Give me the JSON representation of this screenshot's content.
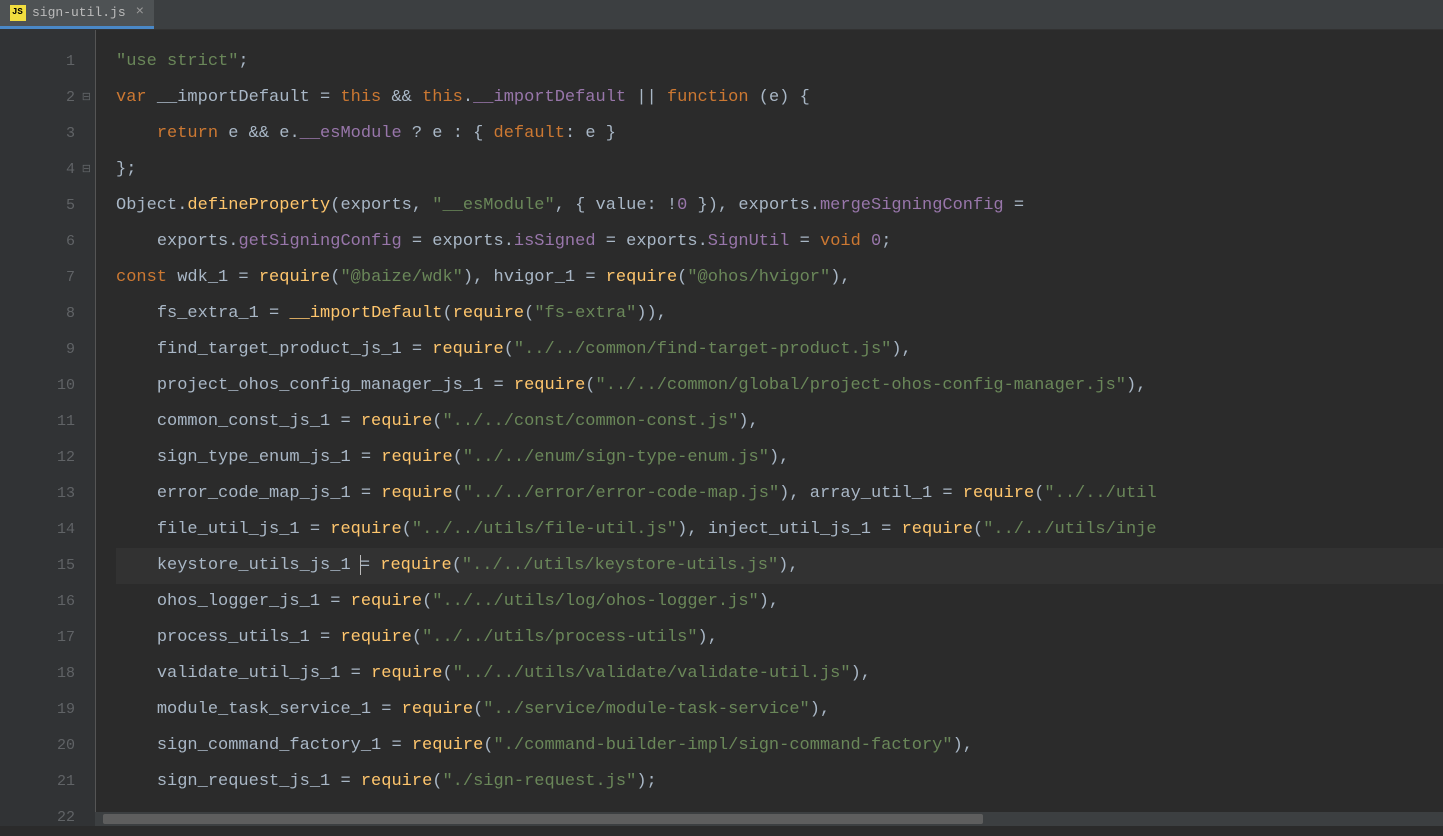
{
  "tab": {
    "filename": "sign-util.js",
    "icon_label": "JS"
  },
  "gutter": {
    "lines": [
      "1",
      "2",
      "3",
      "4",
      "5",
      "6",
      "7",
      "8",
      "9",
      "10",
      "11",
      "12",
      "13",
      "14",
      "15",
      "16",
      "17",
      "18",
      "19",
      "20",
      "21",
      "22"
    ]
  },
  "code": {
    "current_line_index": 14,
    "lines": [
      [
        {
          "t": "str",
          "v": "\"use strict\""
        },
        {
          "t": "op",
          "v": ";"
        }
      ],
      [
        {
          "t": "kw",
          "v": "var"
        },
        {
          "t": "op",
          "v": " "
        },
        {
          "t": "ident",
          "v": "__importDefault"
        },
        {
          "t": "op",
          "v": " = "
        },
        {
          "t": "kw",
          "v": "this"
        },
        {
          "t": "op",
          "v": " && "
        },
        {
          "t": "kw",
          "v": "this"
        },
        {
          "t": "op",
          "v": "."
        },
        {
          "t": "prop",
          "v": "__importDefault"
        },
        {
          "t": "op",
          "v": " || "
        },
        {
          "t": "kw",
          "v": "function"
        },
        {
          "t": "op",
          "v": " ("
        },
        {
          "t": "ident",
          "v": "e"
        },
        {
          "t": "op",
          "v": ") {"
        }
      ],
      [
        {
          "t": "op",
          "v": "    "
        },
        {
          "t": "kw",
          "v": "return"
        },
        {
          "t": "op",
          "v": " "
        },
        {
          "t": "ident",
          "v": "e"
        },
        {
          "t": "op",
          "v": " && "
        },
        {
          "t": "ident",
          "v": "e"
        },
        {
          "t": "op",
          "v": "."
        },
        {
          "t": "prop",
          "v": "__esModule"
        },
        {
          "t": "op",
          "v": " ? "
        },
        {
          "t": "ident",
          "v": "e"
        },
        {
          "t": "op",
          "v": " : { "
        },
        {
          "t": "kw",
          "v": "default"
        },
        {
          "t": "op",
          "v": ": "
        },
        {
          "t": "ident",
          "v": "e"
        },
        {
          "t": "op",
          "v": " }"
        }
      ],
      [
        {
          "t": "op",
          "v": "};"
        }
      ],
      [
        {
          "t": "ident",
          "v": "Object"
        },
        {
          "t": "op",
          "v": "."
        },
        {
          "t": "fn",
          "v": "defineProperty"
        },
        {
          "t": "op",
          "v": "("
        },
        {
          "t": "ident",
          "v": "exports"
        },
        {
          "t": "op",
          "v": ", "
        },
        {
          "t": "str",
          "v": "\"__esModule\""
        },
        {
          "t": "op",
          "v": ", { "
        },
        {
          "t": "ident",
          "v": "value"
        },
        {
          "t": "op",
          "v": ": !"
        },
        {
          "t": "prop",
          "v": "0"
        },
        {
          "t": "op",
          "v": " }), "
        },
        {
          "t": "ident",
          "v": "exports"
        },
        {
          "t": "op",
          "v": "."
        },
        {
          "t": "prop",
          "v": "mergeSigningConfig"
        },
        {
          "t": "op",
          "v": " ="
        }
      ],
      [
        {
          "t": "op",
          "v": "    "
        },
        {
          "t": "ident",
          "v": "exports"
        },
        {
          "t": "op",
          "v": "."
        },
        {
          "t": "prop",
          "v": "getSigningConfig"
        },
        {
          "t": "op",
          "v": " = "
        },
        {
          "t": "ident",
          "v": "exports"
        },
        {
          "t": "op",
          "v": "."
        },
        {
          "t": "prop",
          "v": "isSigned"
        },
        {
          "t": "op",
          "v": " = "
        },
        {
          "t": "ident",
          "v": "exports"
        },
        {
          "t": "op",
          "v": "."
        },
        {
          "t": "prop",
          "v": "SignUtil"
        },
        {
          "t": "op",
          "v": " = "
        },
        {
          "t": "kw",
          "v": "void"
        },
        {
          "t": "op",
          "v": " "
        },
        {
          "t": "prop",
          "v": "0"
        },
        {
          "t": "op",
          "v": ";"
        }
      ],
      [
        {
          "t": "kw",
          "v": "const"
        },
        {
          "t": "op",
          "v": " "
        },
        {
          "t": "ident",
          "v": "wdk_1"
        },
        {
          "t": "op",
          "v": " = "
        },
        {
          "t": "fn",
          "v": "require"
        },
        {
          "t": "op",
          "v": "("
        },
        {
          "t": "str",
          "v": "\"@baize/wdk\""
        },
        {
          "t": "op",
          "v": "), "
        },
        {
          "t": "ident",
          "v": "hvigor_1"
        },
        {
          "t": "op",
          "v": " = "
        },
        {
          "t": "fn",
          "v": "require"
        },
        {
          "t": "op",
          "v": "("
        },
        {
          "t": "str",
          "v": "\"@ohos/hvigor\""
        },
        {
          "t": "op",
          "v": "),"
        }
      ],
      [
        {
          "t": "op",
          "v": "    "
        },
        {
          "t": "ident",
          "v": "fs_extra_1"
        },
        {
          "t": "op",
          "v": " = "
        },
        {
          "t": "fn",
          "v": "__importDefault"
        },
        {
          "t": "op",
          "v": "("
        },
        {
          "t": "fn",
          "v": "require"
        },
        {
          "t": "op",
          "v": "("
        },
        {
          "t": "str",
          "v": "\"fs-extra\""
        },
        {
          "t": "op",
          "v": ")),"
        }
      ],
      [
        {
          "t": "op",
          "v": "    "
        },
        {
          "t": "ident",
          "v": "find_target_product_js_1"
        },
        {
          "t": "op",
          "v": " = "
        },
        {
          "t": "fn",
          "v": "require"
        },
        {
          "t": "op",
          "v": "("
        },
        {
          "t": "str",
          "v": "\"../../common/find-target-product.js\""
        },
        {
          "t": "op",
          "v": "),"
        }
      ],
      [
        {
          "t": "op",
          "v": "    "
        },
        {
          "t": "ident",
          "v": "project_ohos_config_manager_js_1"
        },
        {
          "t": "op",
          "v": " = "
        },
        {
          "t": "fn",
          "v": "require"
        },
        {
          "t": "op",
          "v": "("
        },
        {
          "t": "str",
          "v": "\"../../common/global/project-ohos-config-manager.js\""
        },
        {
          "t": "op",
          "v": "),"
        }
      ],
      [
        {
          "t": "op",
          "v": "    "
        },
        {
          "t": "ident",
          "v": "common_const_js_1"
        },
        {
          "t": "op",
          "v": " = "
        },
        {
          "t": "fn",
          "v": "require"
        },
        {
          "t": "op",
          "v": "("
        },
        {
          "t": "str",
          "v": "\"../../const/common-const.js\""
        },
        {
          "t": "op",
          "v": "),"
        }
      ],
      [
        {
          "t": "op",
          "v": "    "
        },
        {
          "t": "ident",
          "v": "sign_type_enum_js_1"
        },
        {
          "t": "op",
          "v": " = "
        },
        {
          "t": "fn",
          "v": "require"
        },
        {
          "t": "op",
          "v": "("
        },
        {
          "t": "str",
          "v": "\"../../enum/sign-type-enum.js\""
        },
        {
          "t": "op",
          "v": "),"
        }
      ],
      [
        {
          "t": "op",
          "v": "    "
        },
        {
          "t": "ident",
          "v": "error_code_map_js_1"
        },
        {
          "t": "op",
          "v": " = "
        },
        {
          "t": "fn",
          "v": "require"
        },
        {
          "t": "op",
          "v": "("
        },
        {
          "t": "str",
          "v": "\"../../error/error-code-map.js\""
        },
        {
          "t": "op",
          "v": "), "
        },
        {
          "t": "ident",
          "v": "array_util_1"
        },
        {
          "t": "op",
          "v": " = "
        },
        {
          "t": "fn",
          "v": "require"
        },
        {
          "t": "op",
          "v": "("
        },
        {
          "t": "str",
          "v": "\"../../util"
        }
      ],
      [
        {
          "t": "op",
          "v": "    "
        },
        {
          "t": "ident",
          "v": "file_util_js_1"
        },
        {
          "t": "op",
          "v": " = "
        },
        {
          "t": "fn",
          "v": "require"
        },
        {
          "t": "op",
          "v": "("
        },
        {
          "t": "str",
          "v": "\"../../utils/file-util.js\""
        },
        {
          "t": "op",
          "v": "), "
        },
        {
          "t": "ident",
          "v": "inject_util_js_1"
        },
        {
          "t": "op",
          "v": " = "
        },
        {
          "t": "fn",
          "v": "require"
        },
        {
          "t": "op",
          "v": "("
        },
        {
          "t": "str",
          "v": "\"../../utils/inje"
        }
      ],
      [
        {
          "t": "op",
          "v": "    "
        },
        {
          "t": "ident",
          "v": "keystore_utils_js_1"
        },
        {
          "t": "op",
          "v": " "
        },
        {
          "t": "cursor",
          "v": ""
        },
        {
          "t": "op",
          "v": "= "
        },
        {
          "t": "fn",
          "v": "require"
        },
        {
          "t": "op",
          "v": "("
        },
        {
          "t": "str",
          "v": "\"../../utils/keystore-utils.js\""
        },
        {
          "t": "op",
          "v": "),"
        }
      ],
      [
        {
          "t": "op",
          "v": "    "
        },
        {
          "t": "ident",
          "v": "ohos_logger_js_1"
        },
        {
          "t": "op",
          "v": " = "
        },
        {
          "t": "fn",
          "v": "require"
        },
        {
          "t": "op",
          "v": "("
        },
        {
          "t": "str",
          "v": "\"../../utils/log/ohos-logger.js\""
        },
        {
          "t": "op",
          "v": "),"
        }
      ],
      [
        {
          "t": "op",
          "v": "    "
        },
        {
          "t": "ident",
          "v": "process_utils_1"
        },
        {
          "t": "op",
          "v": " = "
        },
        {
          "t": "fn",
          "v": "require"
        },
        {
          "t": "op",
          "v": "("
        },
        {
          "t": "str",
          "v": "\"../../utils/process-utils\""
        },
        {
          "t": "op",
          "v": "),"
        }
      ],
      [
        {
          "t": "op",
          "v": "    "
        },
        {
          "t": "ident",
          "v": "validate_util_js_1"
        },
        {
          "t": "op",
          "v": " = "
        },
        {
          "t": "fn",
          "v": "require"
        },
        {
          "t": "op",
          "v": "("
        },
        {
          "t": "str",
          "v": "\"../../utils/validate/validate-util.js\""
        },
        {
          "t": "op",
          "v": "),"
        }
      ],
      [
        {
          "t": "op",
          "v": "    "
        },
        {
          "t": "ident",
          "v": "module_task_service_1"
        },
        {
          "t": "op",
          "v": " = "
        },
        {
          "t": "fn",
          "v": "require"
        },
        {
          "t": "op",
          "v": "("
        },
        {
          "t": "str",
          "v": "\"../service/module-task-service\""
        },
        {
          "t": "op",
          "v": "),"
        }
      ],
      [
        {
          "t": "op",
          "v": "    "
        },
        {
          "t": "ident",
          "v": "sign_command_factory_1"
        },
        {
          "t": "op",
          "v": " = "
        },
        {
          "t": "fn",
          "v": "require"
        },
        {
          "t": "op",
          "v": "("
        },
        {
          "t": "str",
          "v": "\"./command-builder-impl/sign-command-factory\""
        },
        {
          "t": "op",
          "v": "),"
        }
      ],
      [
        {
          "t": "op",
          "v": "    "
        },
        {
          "t": "ident",
          "v": "sign_request_js_1"
        },
        {
          "t": "op",
          "v": " = "
        },
        {
          "t": "fn",
          "v": "require"
        },
        {
          "t": "op",
          "v": "("
        },
        {
          "t": "str",
          "v": "\"./sign-request.js\""
        },
        {
          "t": "op",
          "v": ");"
        }
      ],
      []
    ]
  }
}
